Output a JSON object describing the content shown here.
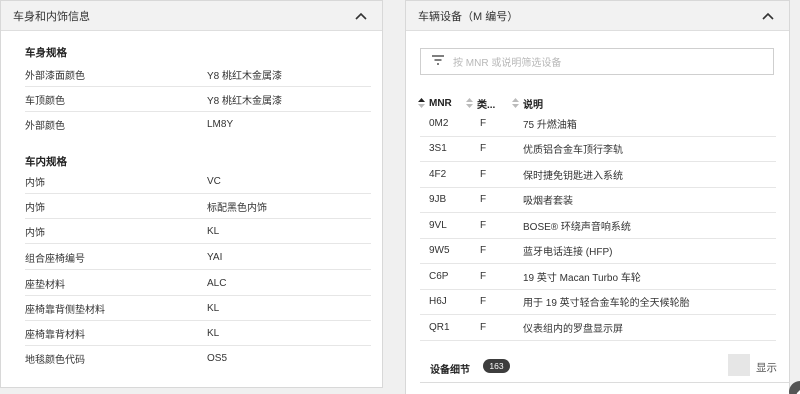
{
  "left_panel": {
    "title": "车身和内饰信息",
    "body_section": {
      "title": "车身规格",
      "rows": [
        {
          "key": "外部漆面颜色",
          "value": "Y8 桃红木金属漆"
        },
        {
          "key": "车顶颜色",
          "value": "Y8 桃红木金属漆"
        },
        {
          "key": "外部颜色",
          "value": "LM8Y"
        }
      ]
    },
    "interior_section": {
      "title": "车内规格",
      "rows": [
        {
          "key": "内饰",
          "value": "VC"
        },
        {
          "key": "内饰",
          "value": "标配黑色内饰"
        },
        {
          "key": "内饰",
          "value": "KL"
        },
        {
          "key": "组合座椅编号",
          "value": "YAI"
        },
        {
          "key": "座垫材料",
          "value": "ALC"
        },
        {
          "key": "座椅靠背侧垫材料",
          "value": "KL"
        },
        {
          "key": "座椅靠背材料",
          "value": "KL"
        },
        {
          "key": "地毯颜色代码",
          "value": "OS5"
        }
      ]
    }
  },
  "right_panel": {
    "title": "车辆设备（M 编号）",
    "search": {
      "placeholder": "按 MNR 或说明筛选设备"
    },
    "columns": {
      "mnr": "MNR",
      "type": "类...",
      "desc": "说明"
    },
    "rows": [
      {
        "mnr": "0M2",
        "type": "F",
        "desc": "75 升燃油箱"
      },
      {
        "mnr": "3S1",
        "type": "F",
        "desc": "优质铝合金车顶行李轨"
      },
      {
        "mnr": "4F2",
        "type": "F",
        "desc": "保时捷免钥匙进入系统"
      },
      {
        "mnr": "9JB",
        "type": "F",
        "desc": "吸烟者套装"
      },
      {
        "mnr": "9VL",
        "type": "F",
        "desc": "BOSE® 环绕声音响系统"
      },
      {
        "mnr": "9W5",
        "type": "F",
        "desc": "蓝牙电话连接 (HFP)"
      },
      {
        "mnr": "C6P",
        "type": "F",
        "desc": "19 英寸 Macan Turbo 车轮"
      },
      {
        "mnr": "H6J",
        "type": "F",
        "desc": "用于 19 英寸轻合金车轮的全天候轮胎"
      },
      {
        "mnr": "QR1",
        "type": "F",
        "desc": "仪表组内的罗盘显示屏"
      }
    ],
    "details": {
      "label": "设备细节",
      "count": "163",
      "toggle_label": "显示"
    }
  },
  "icons": {
    "collapse": "chevron-up-icon",
    "filter": "filter-icon",
    "sort": "sort-icon"
  },
  "colors": {
    "panel_bg": "#ffffff",
    "header_bg": "#f2f2f2",
    "badge_bg": "#3d3d3d"
  }
}
